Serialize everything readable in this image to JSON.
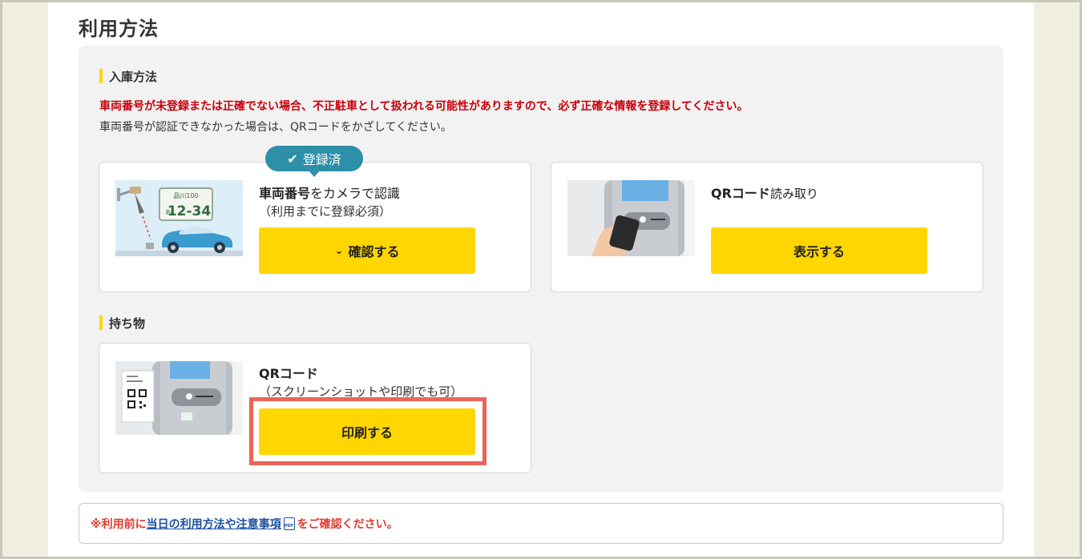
{
  "page": {
    "title": "利用方法"
  },
  "entry": {
    "heading": "入庫方法",
    "warning": "車両番号が未登録または正確でない場合、不正駐車として扱われる可能性がありますので、必ず正確な情報を登録してください。",
    "note": "車両番号が認証できなかった場合は、QRコードをかざしてください。",
    "plate_card": {
      "badge": "登録済",
      "title_bold": "車両番号",
      "title_rest": "をカメラで認識",
      "subtitle": "（利用までに登録必須）",
      "button": "確認する",
      "plate_top": "品川100",
      "plate_kana": "あ",
      "plate_number": "12-34"
    },
    "qr_card": {
      "title_bold": "QRコード",
      "title_rest": "読み取り",
      "button": "表示する"
    }
  },
  "belongings": {
    "heading": "持ち物",
    "card": {
      "title": "QRコード",
      "subtitle": "（スクリーンショットや印刷でも可）",
      "button": "印刷する"
    }
  },
  "footer": {
    "prefix": "※利用前に",
    "link": "当日の利用方法や注意事項",
    "suffix": "をご確認ください。"
  },
  "colors": {
    "accent_yellow": "#ffd600",
    "badge_teal": "#2d8fa8",
    "warning_red": "#c8000b",
    "highlight": "#ec6459"
  }
}
